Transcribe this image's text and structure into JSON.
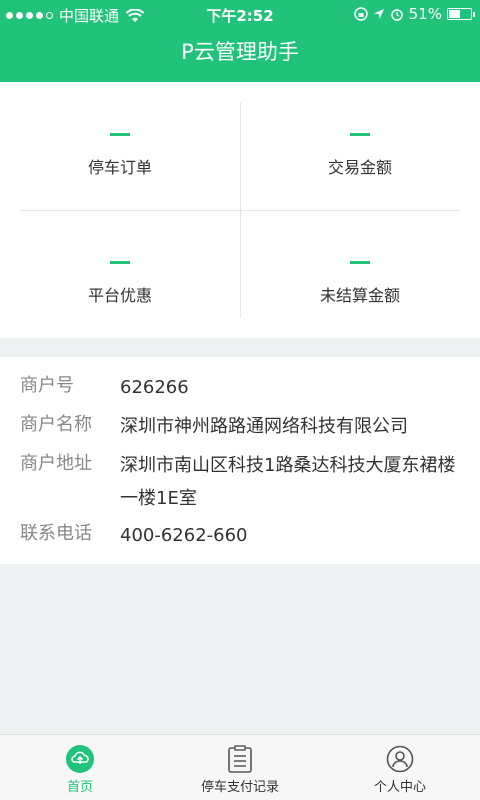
{
  "status_bar": {
    "carrier": "中国联通",
    "time": "下午2:52",
    "battery": "51%",
    "battery_level": 0.51
  },
  "header": {
    "title": "P云管理助手"
  },
  "stats": [
    {
      "value": "—",
      "label": "停车订单"
    },
    {
      "value": "—",
      "label": "交易金额"
    },
    {
      "value": "—",
      "label": "平台优惠"
    },
    {
      "value": "—",
      "label": "未结算金额"
    }
  ],
  "merchant": [
    {
      "key": "商户号",
      "value": "626266"
    },
    {
      "key": "商户名称",
      "value": "深圳市神州路路通网络科技有限公司"
    },
    {
      "key": "商户地址",
      "value": "深圳市南山区科技1路桑达科技大厦东裙楼一楼1E室"
    },
    {
      "key": "联系电话",
      "value": "400-6262-660"
    }
  ],
  "tabs": [
    {
      "label": "首页",
      "icon": "cloud-icon",
      "active": true
    },
    {
      "label": "停车支付记录",
      "icon": "document-icon",
      "active": false
    },
    {
      "label": "个人中心",
      "icon": "user-icon",
      "active": false
    }
  ],
  "colors": {
    "accent": "#21c27a"
  }
}
